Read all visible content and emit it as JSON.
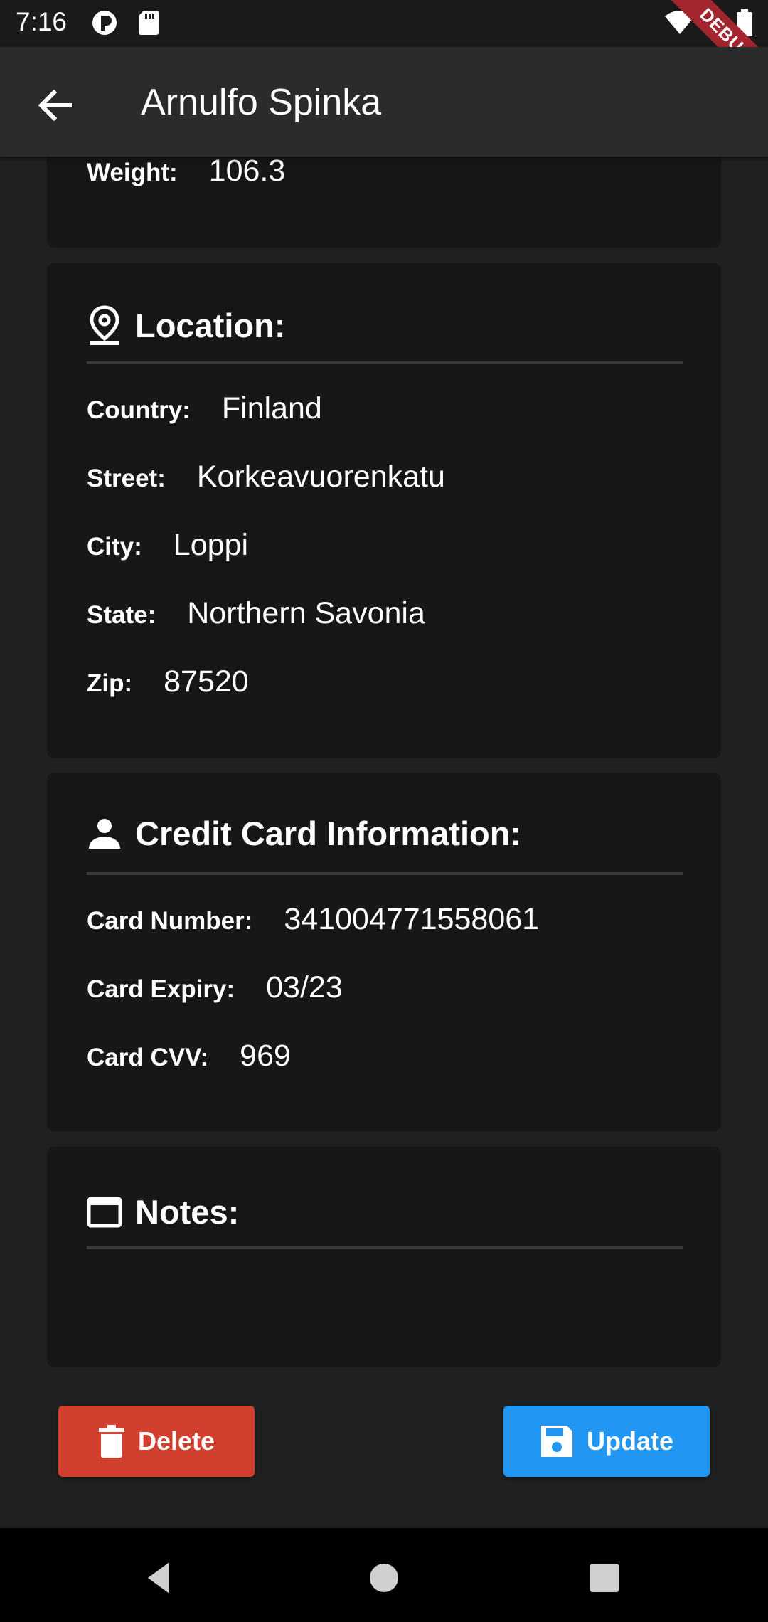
{
  "status_bar": {
    "time": "7:16",
    "icons": [
      "data-saver-icon",
      "sd-card-icon",
      "wifi-icon",
      "battery-icon"
    ],
    "debug_banner": "DEBUG"
  },
  "app_bar": {
    "title": "Arnulfo Spinka",
    "back_icon": "arrow-back-icon"
  },
  "weight_card": {
    "weight_label": "Weight:",
    "weight_value": "106.3"
  },
  "location": {
    "title": "Location:",
    "icon": "location-pin-icon",
    "rows": [
      {
        "label": "Country:",
        "value": "Finland"
      },
      {
        "label": "Street:",
        "value": "Korkeavuorenkatu"
      },
      {
        "label": "City:",
        "value": "Loppi"
      },
      {
        "label": "State:",
        "value": "Northern Savonia"
      },
      {
        "label": "Zip:",
        "value": "87520"
      }
    ]
  },
  "credit_card": {
    "title": "Credit Card Information:",
    "icon": "person-icon",
    "rows": [
      {
        "label": "Card Number:",
        "value": "341004771558061"
      },
      {
        "label": "Card Expiry:",
        "value": "03/23"
      },
      {
        "label": "Card CVV:",
        "value": "969"
      }
    ]
  },
  "notes": {
    "title": "Notes:",
    "icon": "window-icon",
    "text": ""
  },
  "actions": {
    "delete_label": "Delete",
    "update_label": "Update"
  },
  "colors": {
    "background": "#202020",
    "card": "#171717",
    "app_bar": "#2b2b2b",
    "delete": "#d1402f",
    "update": "#2196f3",
    "debug": "#a3252d"
  }
}
